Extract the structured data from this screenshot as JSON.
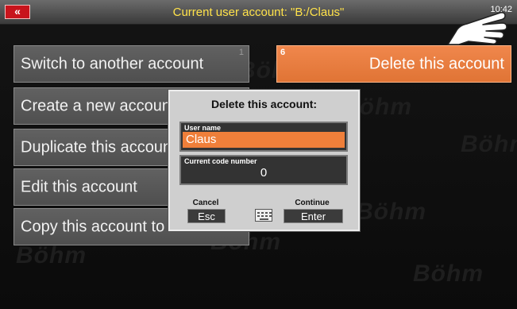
{
  "topbar": {
    "back_glyph": "«",
    "title": "Current user account: \"B:/Claus\"",
    "clock": "10:42",
    "pointer_icon": "hand-pointer-icon"
  },
  "watermark": "Böhm",
  "menu": {
    "left": [
      {
        "label": "Switch to another account",
        "num": "1"
      },
      {
        "label": "Create a new account"
      },
      {
        "label": "Duplicate this account"
      },
      {
        "label": "Edit this account"
      },
      {
        "label": "Copy this account to USB"
      }
    ],
    "right": {
      "label": "Delete this account",
      "num": "6"
    }
  },
  "dialog": {
    "title": "Delete this account:",
    "user_label": "User name",
    "user_value": "Claus",
    "code_label": "Current code number",
    "code_value": "0",
    "cancel_caption": "Cancel",
    "cancel_key": "Esc",
    "continue_caption": "Continue",
    "continue_key": "Enter",
    "keyboard_icon": "keyboard-icon"
  },
  "colors": {
    "accent_orange": "#ef7f3a",
    "title_yellow": "#ffe24a",
    "back_red": "#c8141c"
  }
}
